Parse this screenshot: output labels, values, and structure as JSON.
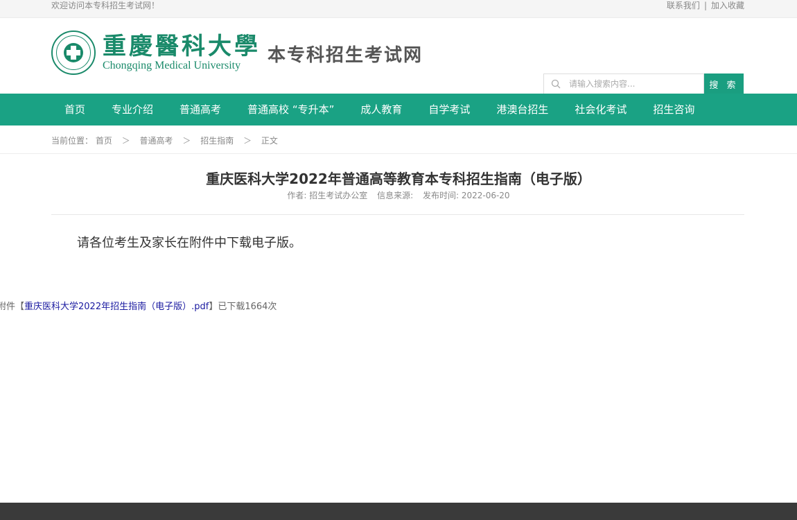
{
  "topbar": {
    "welcome": "欢迎访问本专科招生考试网！",
    "contact": "联系我们",
    "separator": "|",
    "bookmark": "加入收藏"
  },
  "logo": {
    "name_cn": "重慶醫科大學",
    "name_en": "Chongqing Medical University",
    "site_name": "本专科招生考试网"
  },
  "search": {
    "placeholder": "请输入搜索内容...",
    "button": "搜 索"
  },
  "nav": {
    "items": [
      "首页",
      "专业介绍",
      "普通高考",
      "普通高校 “专升本”",
      "成人教育",
      "自学考试",
      "港澳台招生",
      "社会化考试",
      "招生咨询"
    ]
  },
  "breadcrumb": {
    "prefix": "当前位置：",
    "items": [
      "首页",
      "普通高考",
      "招生指南",
      "正文"
    ],
    "arrow": "＞"
  },
  "article": {
    "title": "重庆医科大学2022年普通高等教育本专科招生指南（电子版）",
    "author": "作者: 招生考试办公室",
    "source": "信息来源:",
    "date": "发布时间: 2022-06-20",
    "body": "请各位考生及家长在附件中下载电子版。",
    "attachment_prefix": "附件【",
    "attachment_link": "重庆医科大学2022年招生指南（电子版）.pdf",
    "attachment_suffix": "】已下载1664次"
  },
  "colors": {
    "brand": "#1aa284",
    "footer": "#3a3a3a"
  }
}
